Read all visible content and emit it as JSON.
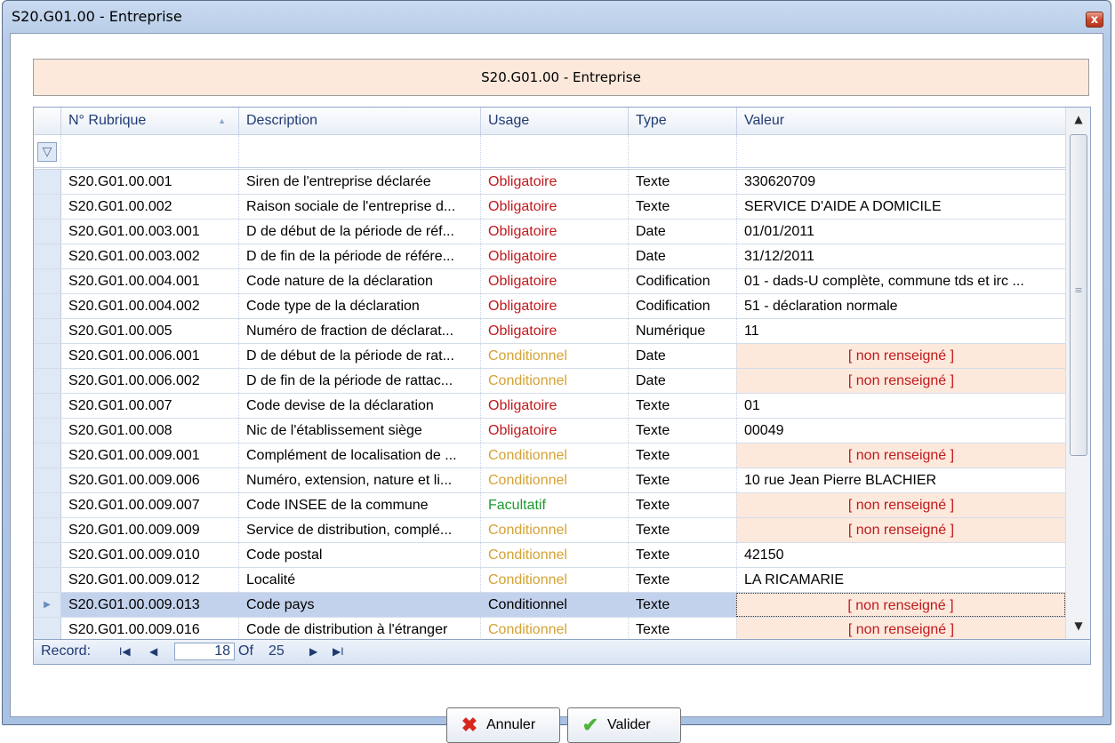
{
  "window": {
    "title": "S20.G01.00 - Entreprise",
    "close_label": "x"
  },
  "panel": {
    "title": "S20.G01.00 - Entreprise"
  },
  "grid": {
    "columns": [
      "N° Rubrique",
      "Description",
      "Usage",
      "Type",
      "Valeur"
    ],
    "rows": [
      {
        "code": "S20.G01.00.001",
        "description": "Siren de l'entreprise déclarée",
        "usage": "Obligatoire",
        "type": "Texte",
        "value": "330620709"
      },
      {
        "code": "S20.G01.00.002",
        "description": "Raison sociale de l'entreprise d...",
        "usage": "Obligatoire",
        "type": "Texte",
        "value": "SERVICE D'AIDE A DOMICILE"
      },
      {
        "code": "S20.G01.00.003.001",
        "description": "D de début de la période de réf...",
        "usage": "Obligatoire",
        "type": "Date",
        "value": "01/01/2011"
      },
      {
        "code": "S20.G01.00.003.002",
        "description": "D de fin de la période de référe...",
        "usage": "Obligatoire",
        "type": "Date",
        "value": "31/12/2011"
      },
      {
        "code": "S20.G01.00.004.001",
        "description": "Code nature de la déclaration",
        "usage": "Obligatoire",
        "type": "Codification",
        "value": "01 - dads-U complète, commune tds et irc ..."
      },
      {
        "code": "S20.G01.00.004.002",
        "description": "Code type de la déclaration",
        "usage": "Obligatoire",
        "type": "Codification",
        "value": "51 - déclaration normale"
      },
      {
        "code": "S20.G01.00.005",
        "description": "Numéro de fraction de déclarat...",
        "usage": "Obligatoire",
        "type": "Numérique",
        "value": "11"
      },
      {
        "code": "S20.G01.00.006.001",
        "description": "D de début de la période de rat...",
        "usage": "Conditionnel",
        "type": "Date",
        "value": "[ non renseigné ]"
      },
      {
        "code": "S20.G01.00.006.002",
        "description": "D de fin de la période de rattac...",
        "usage": "Conditionnel",
        "type": "Date",
        "value": "[ non renseigné ]"
      },
      {
        "code": "S20.G01.00.007",
        "description": "Code devise de la déclaration",
        "usage": "Obligatoire",
        "type": "Texte",
        "value": "01"
      },
      {
        "code": "S20.G01.00.008",
        "description": "Nic de l'établissement siège",
        "usage": "Obligatoire",
        "type": "Texte",
        "value": "00049"
      },
      {
        "code": "S20.G01.00.009.001",
        "description": "Complément de localisation de ...",
        "usage": "Conditionnel",
        "type": "Texte",
        "value": "[ non renseigné ]"
      },
      {
        "code": "S20.G01.00.009.006",
        "description": "Numéro, extension, nature et li...",
        "usage": "Conditionnel",
        "type": "Texte",
        "value": "10 rue Jean Pierre BLACHIER"
      },
      {
        "code": "S20.G01.00.009.007",
        "description": "Code INSEE de la commune",
        "usage": "Facultatif",
        "type": "Texte",
        "value": "[ non renseigné ]"
      },
      {
        "code": "S20.G01.00.009.009",
        "description": "Service de distribution, complé...",
        "usage": "Conditionnel",
        "type": "Texte",
        "value": "[ non renseigné ]"
      },
      {
        "code": "S20.G01.00.009.010",
        "description": "Code postal",
        "usage": "Conditionnel",
        "type": "Texte",
        "value": "42150"
      },
      {
        "code": "S20.G01.00.009.012",
        "description": "Localité",
        "usage": "Conditionnel",
        "type": "Texte",
        "value": "LA RICAMARIE"
      },
      {
        "code": "S20.G01.00.009.013",
        "description": "Code pays",
        "usage": "Conditionnel",
        "type": "Texte",
        "value": "[ non renseigné ]",
        "selected": true
      },
      {
        "code": "S20.G01.00.009.016",
        "description": "Code de distribution à l'étranger",
        "usage": "Conditionnel",
        "type": "Texte",
        "value": "[ non renseigné ]"
      }
    ]
  },
  "navigator": {
    "record_label": "Record:",
    "current": "18",
    "of_label": "Of",
    "total": "25"
  },
  "buttons": {
    "cancel": "Annuler",
    "validate": "Valider"
  },
  "colors": {
    "mandatory": "#c0191d",
    "conditional": "#d4a235",
    "optional": "#1a9a2e",
    "empty_bg": "#fde9dc"
  },
  "icons": {
    "cancel": "red-x-icon",
    "validate": "green-check-icon",
    "filter": "filter-funnel-icon"
  }
}
